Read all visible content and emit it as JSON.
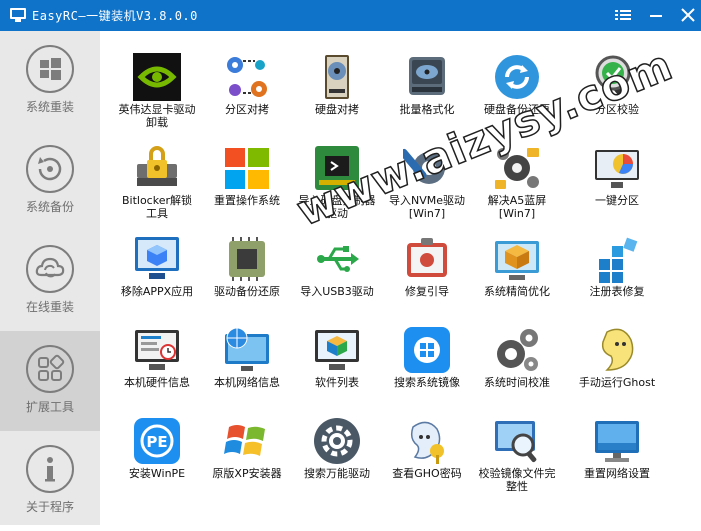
{
  "window": {
    "title": "EasyRC—一键装机V3.8.0.0",
    "menu_icon": "menu-icon",
    "minimize_icon": "minimize-icon",
    "close_icon": "close-icon"
  },
  "colors": {
    "titlebar": "#0e73c9",
    "sidebar": "#e8e8e8",
    "sidebar_active": "#d2d2d2",
    "nav_text": "#6f6f6f"
  },
  "sidebar": {
    "items": [
      {
        "label": "系统重装",
        "icon": "windows-icon"
      },
      {
        "label": "系统备份",
        "icon": "backup-icon"
      },
      {
        "label": "在线重装",
        "icon": "cloud-icon"
      },
      {
        "label": "扩展工具",
        "icon": "apps-icon",
        "active": true
      },
      {
        "label": "关于程序",
        "icon": "info-icon"
      }
    ]
  },
  "tools": [
    {
      "label": "英伟达显卡驱动卸载",
      "l1": "英伟达显卡驱动",
      "l2": "卸载",
      "icon": "nvidia-icon"
    },
    {
      "label": "分区对拷",
      "icon": "partition-copy-icon"
    },
    {
      "label": "硬盘对拷",
      "icon": "hdd-copy-icon"
    },
    {
      "label": "批量格式化",
      "icon": "batch-format-icon"
    },
    {
      "label": "硬盘备份还原",
      "icon": "disk-restore-icon"
    },
    {
      "label": "分区校验",
      "icon": "partition-check-icon"
    },
    {
      "label": "Bitlocker解锁工具",
      "l1": "Bitlocker解锁",
      "l2": "工具",
      "icon": "lock-icon"
    },
    {
      "label": "重置操作系统",
      "icon": "windows-logo-icon"
    },
    {
      "label": "导入硬盘控制器驱动",
      "l1": "导入硬盘控制器",
      "l2": "驱动",
      "icon": "chip-board-icon"
    },
    {
      "label": "导入NVMe驱动[Win7]",
      "l1": "导入NVMe驱动",
      "l2": "[Win7]",
      "icon": "wrench-gear-icon"
    },
    {
      "label": "解决A5蓝屏[Win7]",
      "l1": "解决A5蓝屏",
      "l2": "[Win7]",
      "icon": "gears-folder-icon"
    },
    {
      "label": "一键分区",
      "icon": "pie-monitor-icon"
    },
    {
      "label": "移除APPX应用",
      "icon": "remove-app-icon"
    },
    {
      "label": "驱动备份还原",
      "icon": "cpu-icon"
    },
    {
      "label": "导入USB3驱动",
      "icon": "usb-icon"
    },
    {
      "label": "修复引导",
      "icon": "repair-boot-icon"
    },
    {
      "label": "系统精简优化",
      "icon": "optimize-icon"
    },
    {
      "label": "注册表修复",
      "icon": "registry-icon"
    },
    {
      "label": "本机硬件信息",
      "icon": "hardware-info-icon"
    },
    {
      "label": "本机网络信息",
      "icon": "network-globe-icon"
    },
    {
      "label": "软件列表",
      "icon": "software-list-icon"
    },
    {
      "label": "搜索系统镜像",
      "icon": "search-image-icon"
    },
    {
      "label": "系统时间校准",
      "icon": "time-gears-icon"
    },
    {
      "label": "手动运行Ghost",
      "icon": "ghost-icon"
    },
    {
      "label": "安装WinPE",
      "icon": "winpe-icon"
    },
    {
      "label": "原版XP安装器",
      "icon": "xp-logo-icon"
    },
    {
      "label": "搜索万能驱动",
      "icon": "gear-driver-icon"
    },
    {
      "label": "查看GHO密码",
      "icon": "gho-password-icon"
    },
    {
      "label": "校验镜像文件完整性",
      "l1": "校验镜像文件完",
      "l2": "整性",
      "icon": "verify-image-icon"
    },
    {
      "label": "重置网络设置",
      "icon": "reset-network-icon"
    }
  ],
  "watermark": "www.aizysy.com"
}
